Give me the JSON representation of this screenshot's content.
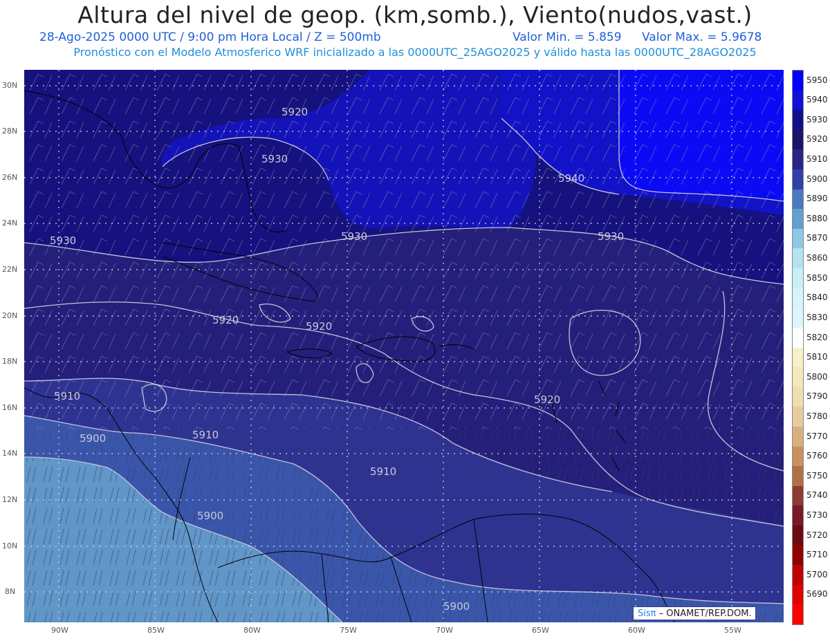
{
  "header": {
    "title": "Altura del nivel de geop. (km,somb.), Viento(nudos,vast.)",
    "date_time": "28-Ago-2025  0000 UTC / 9:00 pm Hora Local / Z = 500mb",
    "value_min": "Valor Min. = 5.859",
    "value_max": "Valor Max. = 5.9678",
    "model_info": "Pronóstico con el Modelo Atmosferico WRF inicializado a las 0000UTC_25AGO2025 y válido hasta las  0000UTC_28AGO2025"
  },
  "axes": {
    "lat_labels": [
      "30N",
      "28N",
      "26N",
      "24N",
      "22N",
      "20N",
      "18N",
      "16N",
      "14N",
      "12N",
      "10N",
      "8N"
    ],
    "lon_labels": [
      "90W",
      "85W",
      "80W",
      "75W",
      "70W",
      "65W",
      "60W",
      "55W"
    ]
  },
  "contour_labels": {
    "c1": "5920",
    "c2": "5930",
    "c3": "5940",
    "c4": "5930",
    "c5": "5930",
    "c6": "5930",
    "c7": "5920",
    "c8": "5920",
    "c9": "5920",
    "c10": "5910",
    "c11": "5910",
    "c12": "5900",
    "c13": "5910",
    "c14": "5900",
    "c15": "5900"
  },
  "colorbar": {
    "levels": [
      "5950",
      "5940",
      "5930",
      "5920",
      "5910",
      "5900",
      "5890",
      "5880",
      "5870",
      "5860",
      "5850",
      "5840",
      "5830",
      "5820",
      "5810",
      "5800",
      "5790",
      "5780",
      "5770",
      "5760",
      "5750",
      "5740",
      "5730",
      "5720",
      "5710",
      "5700",
      "5690"
    ],
    "colors": [
      "#0000ff",
      "#1010d8",
      "#10108c",
      "#1b156a",
      "#2a2486",
      "#3040a8",
      "#4a78bc",
      "#62a0d0",
      "#90c8e4",
      "#b4e2f2",
      "#c8eef6",
      "#d6f4fa",
      "#dcf6fb",
      "#ffffff",
      "#f8f0c8",
      "#f4e8bc",
      "#eedeb0",
      "#e8cca0",
      "#d8b080",
      "#c89060",
      "#b07048",
      "#8c3c30",
      "#781828",
      "#6c0a14",
      "#900000",
      "#c00000",
      "#e00000",
      "#ff0000"
    ]
  },
  "credit": {
    "brand": "Sisπ",
    "text": "– ONAMET/REP.DOM."
  },
  "colors": {
    "band_5950": "#0a10f2",
    "band_5940": "#1010cc",
    "band_5930": "#12107e",
    "band_5920": "#241f7a",
    "band_5910": "#2e3290",
    "band_5900": "#3952a8",
    "band_5890": "#5f94c8",
    "contour": "#c0c0d8",
    "coast": "#000000"
  }
}
